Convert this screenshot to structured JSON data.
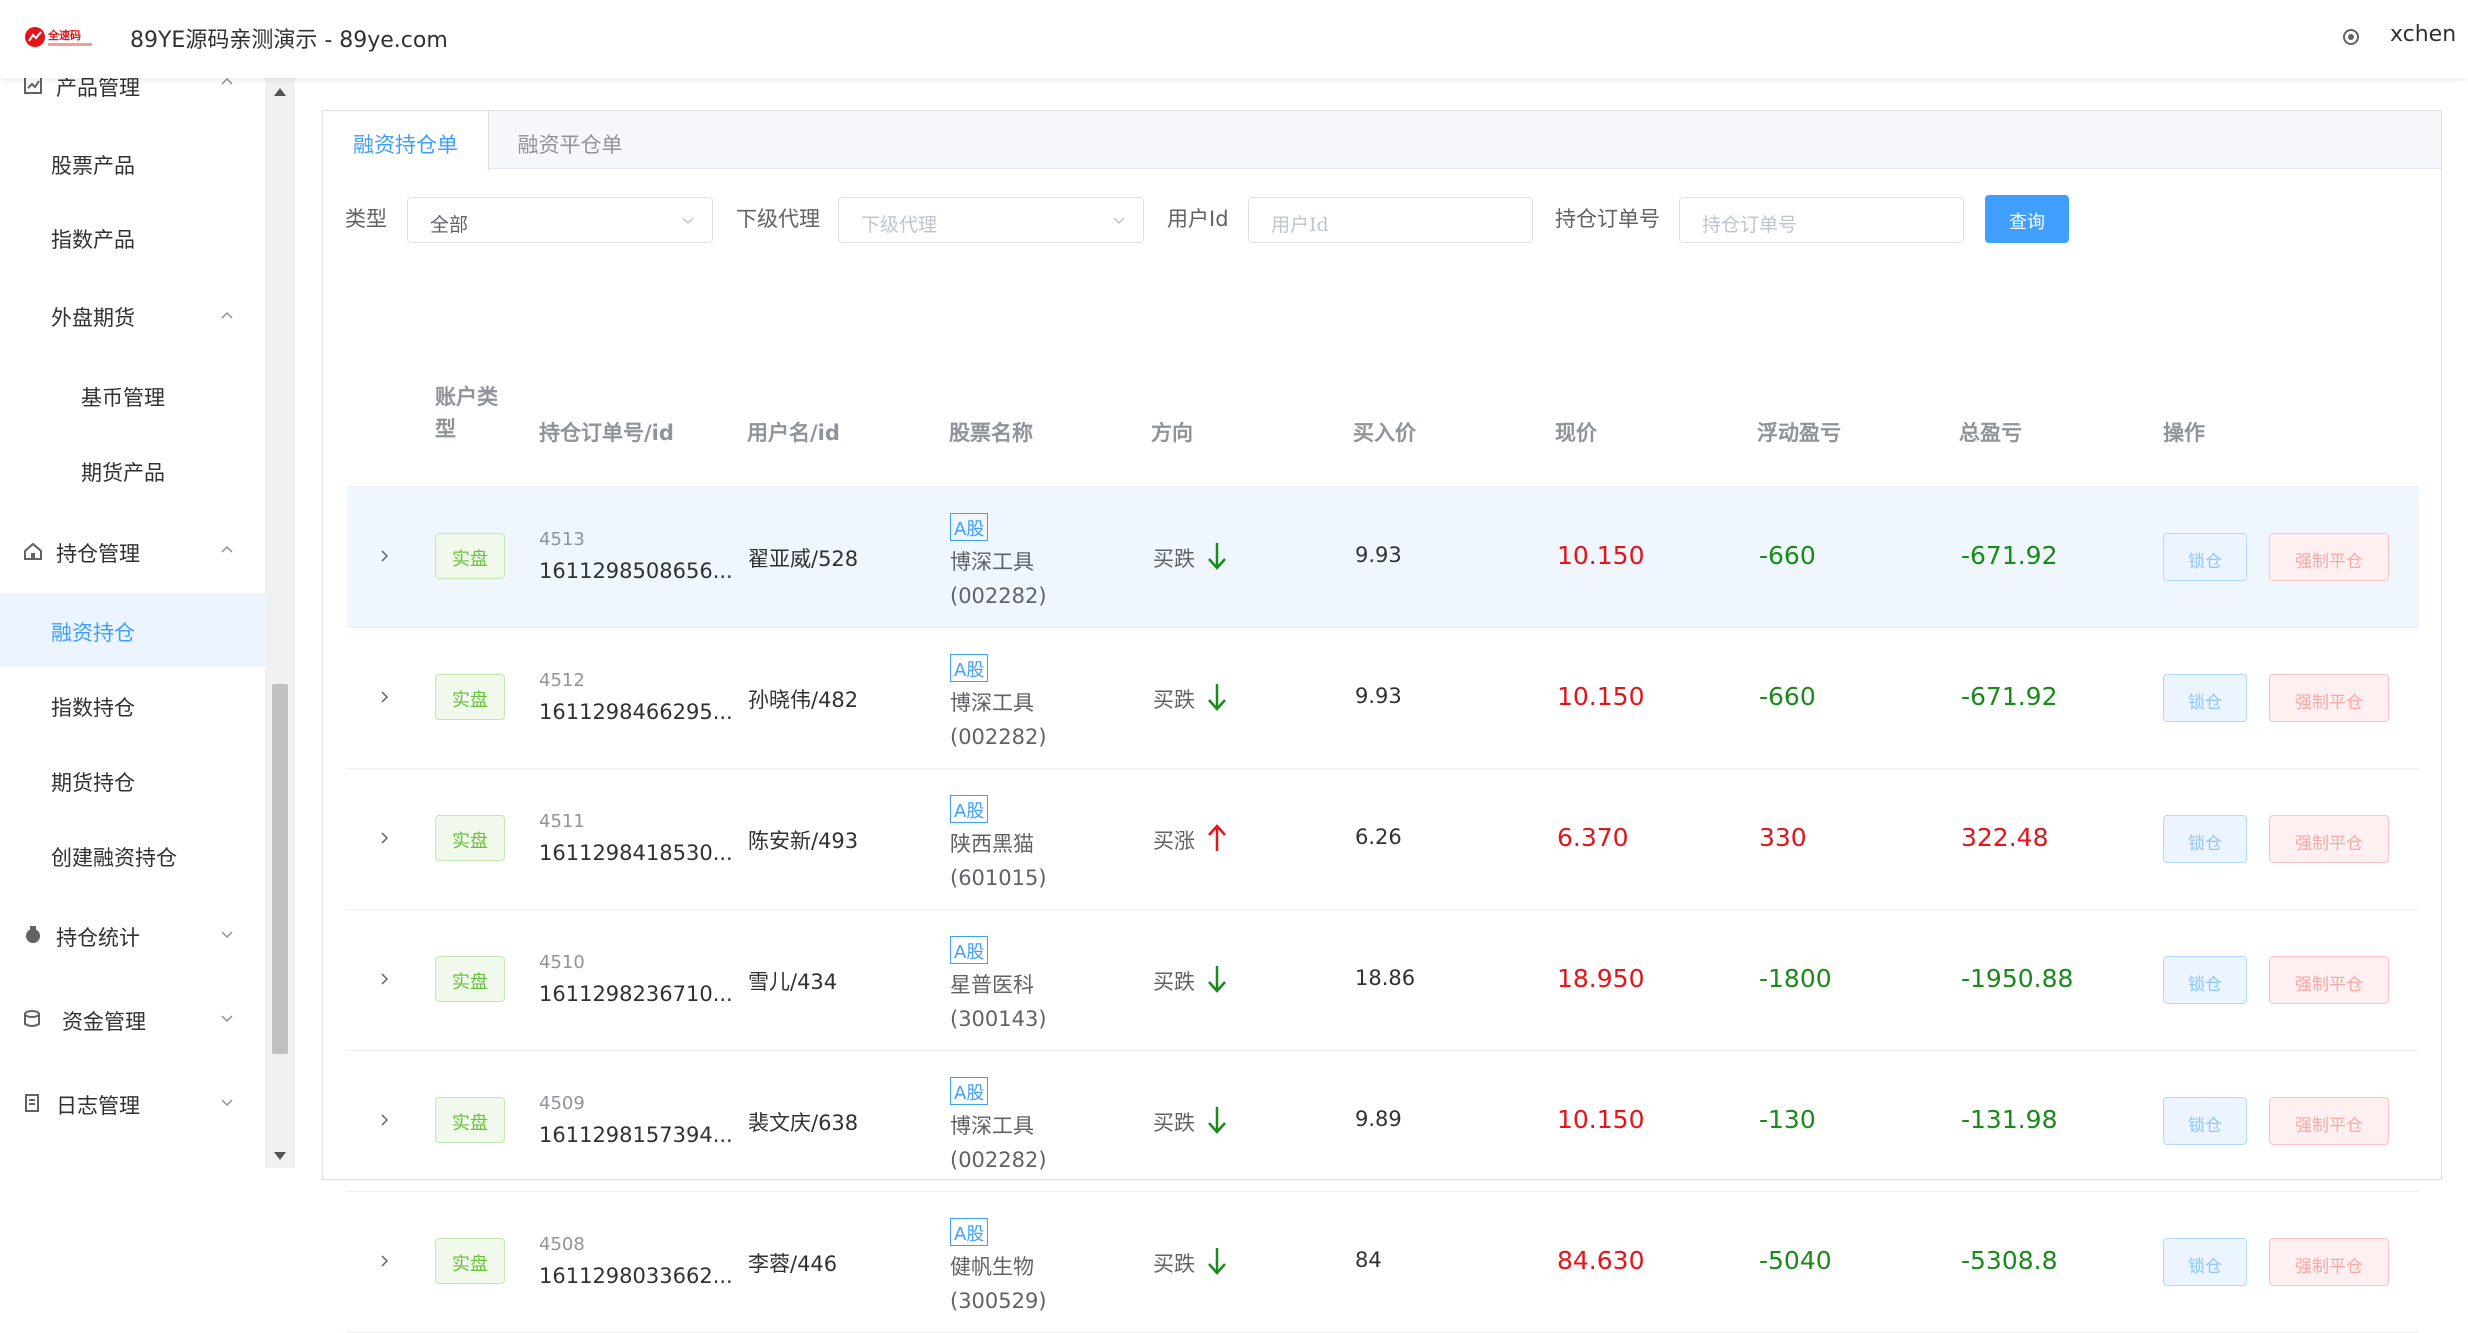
{
  "header": {
    "logo_text": "全速码",
    "title": "89YE源码亲测演示 - 89ye.com",
    "username": "xchen"
  },
  "sidebar": {
    "items": [
      {
        "label": "产品管理",
        "level": 0
      },
      {
        "label": "股票产品",
        "level": 1
      },
      {
        "label": "指数产品",
        "level": 1
      },
      {
        "label": "外盘期货",
        "level": 1
      },
      {
        "label": "基币管理",
        "level": 2
      },
      {
        "label": "期货产品",
        "level": 2
      },
      {
        "label": "持仓管理",
        "level": 0
      },
      {
        "label": "融资持仓",
        "level": 1,
        "active": true
      },
      {
        "label": "指数持仓",
        "level": 1
      },
      {
        "label": "期货持仓",
        "level": 1
      },
      {
        "label": "创建融资持仓",
        "level": 1
      },
      {
        "label": "持仓统计",
        "level": 0
      },
      {
        "label": "资金管理",
        "level": 0
      },
      {
        "label": "日志管理",
        "level": 0
      }
    ]
  },
  "tabs": [
    {
      "label": "融资持仓单",
      "active": true
    },
    {
      "label": "融资平仓单",
      "active": false
    }
  ],
  "filters": {
    "type_label": "类型",
    "type_value": "全部",
    "agent_label": "下级代理",
    "agent_placeholder": "下级代理",
    "userid_label": "用户Id",
    "userid_placeholder": "用户Id",
    "order_label": "持仓订单号",
    "order_placeholder": "持仓订单号",
    "query_button": "查询"
  },
  "table": {
    "headers": {
      "account_type": "账户类型",
      "order": "持仓订单号/id",
      "user": "用户名/id",
      "stock": "股票名称",
      "direction": "方向",
      "buy_price": "买入价",
      "now_price": "现价",
      "float_pl": "浮动盈亏",
      "total_pl": "总盈亏",
      "action": "操作"
    },
    "rows": [
      {
        "type": "实盘",
        "id": "4513",
        "order_no": "1611298508656...",
        "user": "翟亚威/528",
        "tag": "A股",
        "stock": "博深工具 (002282)",
        "direction": "买跌",
        "dir": "down",
        "buy": "9.93",
        "now": "10.150",
        "float": "-660",
        "total": "-671.92",
        "lock": "锁仓",
        "close": "强制平仓"
      },
      {
        "type": "实盘",
        "id": "4512",
        "order_no": "1611298466295...",
        "user": "孙晓伟/482",
        "tag": "A股",
        "stock": "博深工具 (002282)",
        "direction": "买跌",
        "dir": "down",
        "buy": "9.93",
        "now": "10.150",
        "float": "-660",
        "total": "-671.92",
        "lock": "锁仓",
        "close": "强制平仓"
      },
      {
        "type": "实盘",
        "id": "4511",
        "order_no": "1611298418530...",
        "user": "陈安新/493",
        "tag": "A股",
        "stock": "陕西黑猫 (601015)",
        "direction": "买涨",
        "dir": "up",
        "buy": "6.26",
        "now": "6.370",
        "float": "330",
        "total": "322.48",
        "lock": "锁仓",
        "close": "强制平仓"
      },
      {
        "type": "实盘",
        "id": "4510",
        "order_no": "1611298236710...",
        "user": "雪儿/434",
        "tag": "A股",
        "stock": "星普医科 (300143)",
        "direction": "买跌",
        "dir": "down",
        "buy": "18.86",
        "now": "18.950",
        "float": "-1800",
        "total": "-1950.88",
        "lock": "锁仓",
        "close": "强制平仓"
      },
      {
        "type": "实盘",
        "id": "4509",
        "order_no": "1611298157394...",
        "user": "裴文庆/638",
        "tag": "A股",
        "stock": "博深工具 (002282)",
        "direction": "买跌",
        "dir": "down",
        "buy": "9.89",
        "now": "10.150",
        "float": "-130",
        "total": "-131.98",
        "lock": "锁仓",
        "close": "强制平仓"
      },
      {
        "type": "实盘",
        "id": "4508",
        "order_no": "1611298033662...",
        "user": "李蓉/446",
        "tag": "A股",
        "stock": "健帆生物 (300529)",
        "direction": "买跌",
        "dir": "down",
        "buy": "84",
        "now": "84.630",
        "float": "-5040",
        "total": "-5308.8",
        "lock": "锁仓",
        "close": "强制平仓"
      }
    ]
  },
  "colors": {
    "accent": "#409eff",
    "loss": "#e4141b",
    "gain": "#1a8a1a"
  }
}
